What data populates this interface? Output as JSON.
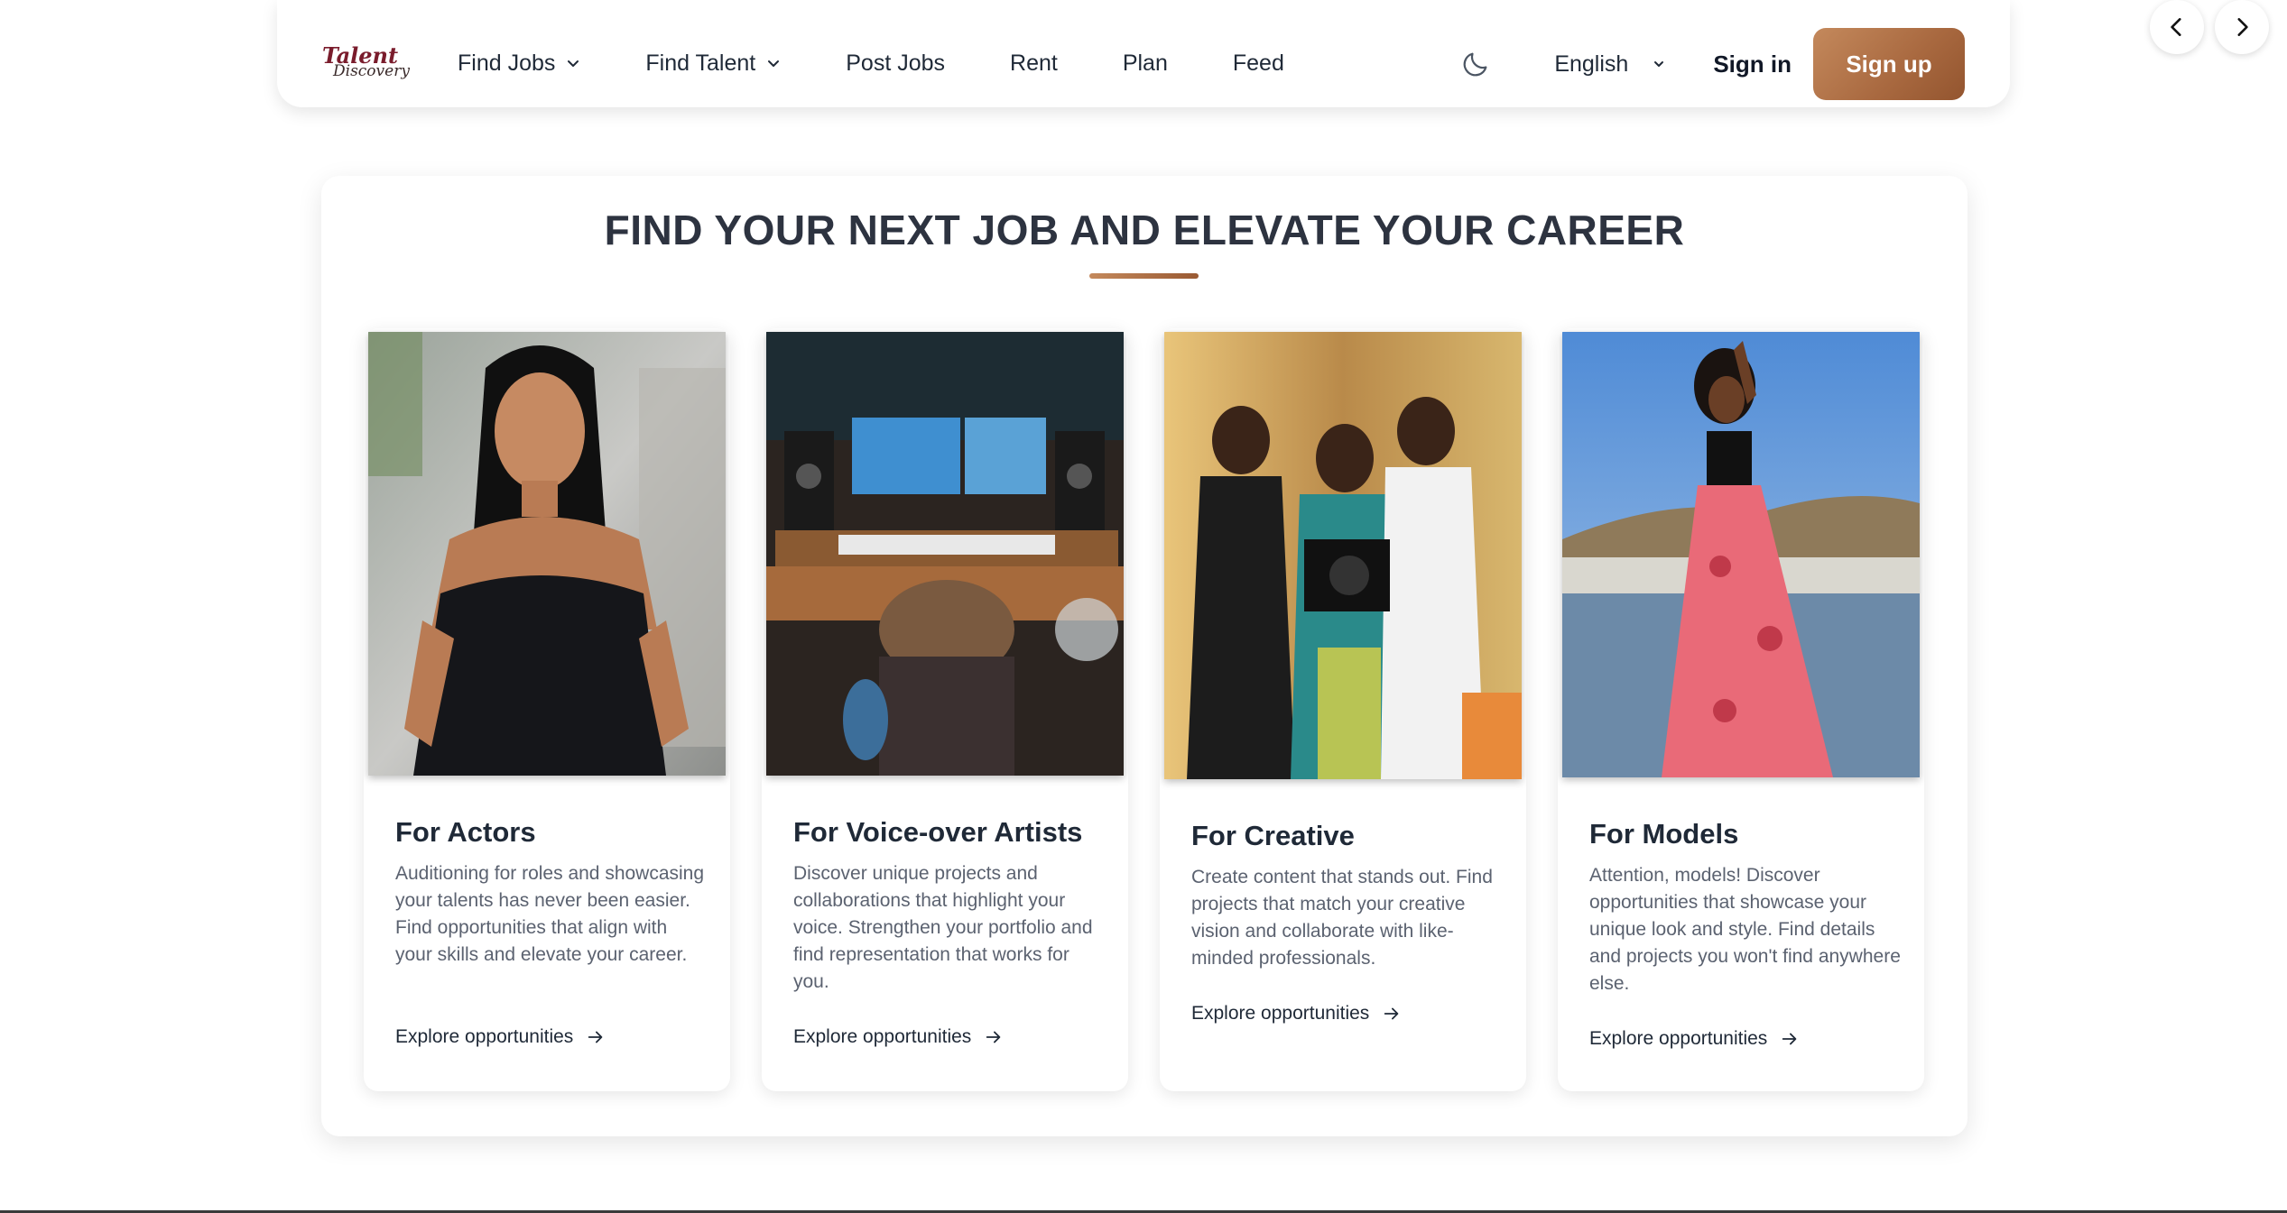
{
  "brand": {
    "logo_line1": "Talent",
    "logo_line2": "Discovery"
  },
  "nav": {
    "items": [
      {
        "label": "Find Jobs",
        "has_dropdown": true
      },
      {
        "label": "Find Talent",
        "has_dropdown": true
      },
      {
        "label": "Post Jobs",
        "has_dropdown": false
      },
      {
        "label": "Rent",
        "has_dropdown": false
      },
      {
        "label": "Plan",
        "has_dropdown": false
      },
      {
        "label": "Feed",
        "has_dropdown": false
      }
    ],
    "theme_toggle_icon": "moon-icon",
    "language": "English",
    "sign_in": "Sign in",
    "sign_up": "Sign up"
  },
  "slider": {
    "prev_icon": "chevron-left-icon",
    "next_icon": "chevron-right-icon"
  },
  "section": {
    "title": "FIND YOUR NEXT JOB AND ELEVATE YOUR CAREER"
  },
  "cards": [
    {
      "title": "For Actors",
      "description": "Auditioning for roles and showcasing your talents has never been easier. Find opportunities that align with your skills and elevate your career.",
      "link": "Explore opportunities"
    },
    {
      "title": "For Voice-over Artists",
      "description": "Discover unique projects and collaborations that highlight your voice. Strengthen your portfolio and find representation that works for you.",
      "link": "Explore opportunities"
    },
    {
      "title": "For Creative",
      "description": "Create content that stands out. Find projects that match your creative vision and collaborate with like-minded professionals.",
      "link": "Explore opportunities"
    },
    {
      "title": "For Models",
      "description": "Attention, models! Discover opportunities that showcase your unique look and style. Find details and projects you won't find anywhere else.",
      "link": "Explore opportunities"
    }
  ],
  "colors": {
    "accent": "#a8683f",
    "accent_light": "#c4895c",
    "heading": "#2d3340",
    "body_text": "#5b6270"
  }
}
